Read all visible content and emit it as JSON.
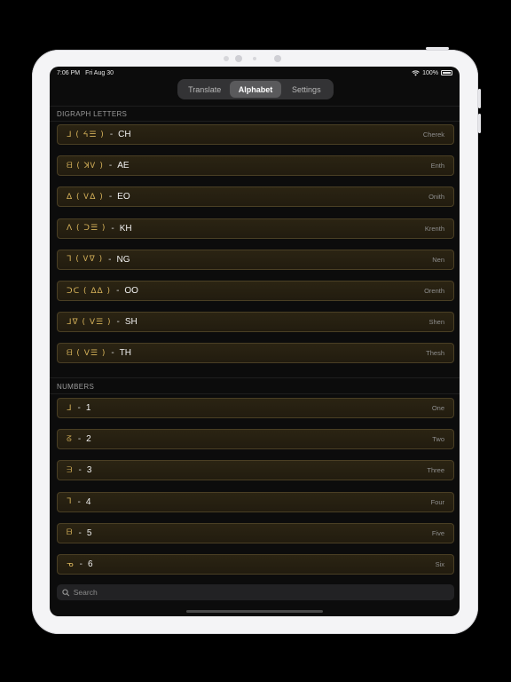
{
  "status": {
    "time": "7:06 PM",
    "date": "Fri Aug 30",
    "battery": "100%"
  },
  "tabs": [
    {
      "label": "Translate"
    },
    {
      "label": "Alphabet"
    },
    {
      "label": "Settings"
    }
  ],
  "digraph": {
    "header": "DIGRAPH LETTERS",
    "rows": [
      {
        "glyph": "ᒧ ( ᔦ☰ )",
        "sep": "-",
        "latin": "CH",
        "name": "Cherek"
      },
      {
        "glyph": "ᗺ ( ꓘᏙ )",
        "sep": "-",
        "latin": "AE",
        "name": "Enth"
      },
      {
        "glyph": "ᐃ ( Ꮩᐃ )",
        "sep": "-",
        "latin": "EO",
        "name": "Onith"
      },
      {
        "glyph": "ᐱ ( ᑐ☰ )",
        "sep": "-",
        "latin": "KH",
        "name": "Krenth"
      },
      {
        "glyph": "ᒣ ( Ꮩᐁ )",
        "sep": "-",
        "latin": "NG",
        "name": "Nen"
      },
      {
        "glyph": "ᑐᑕ ( ᐃᐃ )",
        "sep": "-",
        "latin": "OO",
        "name": "Orenth"
      },
      {
        "glyph": "ᒧᐁ ( ᐯ☰ )",
        "sep": "-",
        "latin": "SH",
        "name": "Shen"
      },
      {
        "glyph": "ᗺ ( ᐯ☰ )",
        "sep": "-",
        "latin": "TH",
        "name": "Thesh"
      }
    ]
  },
  "numbers": {
    "header": "NUMBERS",
    "rows": [
      {
        "glyph": "ᒧ",
        "sep": "-",
        "latin": "1",
        "name": "One"
      },
      {
        "glyph": "ᘔ",
        "sep": "-",
        "latin": "2",
        "name": "Two"
      },
      {
        "glyph": "ᗱ",
        "sep": "-",
        "latin": "3",
        "name": "Three"
      },
      {
        "glyph": "ᒣ",
        "sep": "-",
        "latin": "4",
        "name": "Four"
      },
      {
        "glyph": "ᗷ",
        "sep": "-",
        "latin": "5",
        "name": "Five"
      },
      {
        "glyph": "ᓀ",
        "sep": "-",
        "latin": "6",
        "name": "Six"
      }
    ]
  },
  "search": {
    "placeholder": "Search"
  },
  "colors": {
    "accent_glyph": "#d6b25a",
    "row_bg": "#2b2413",
    "row_border": "#4a3f24"
  }
}
